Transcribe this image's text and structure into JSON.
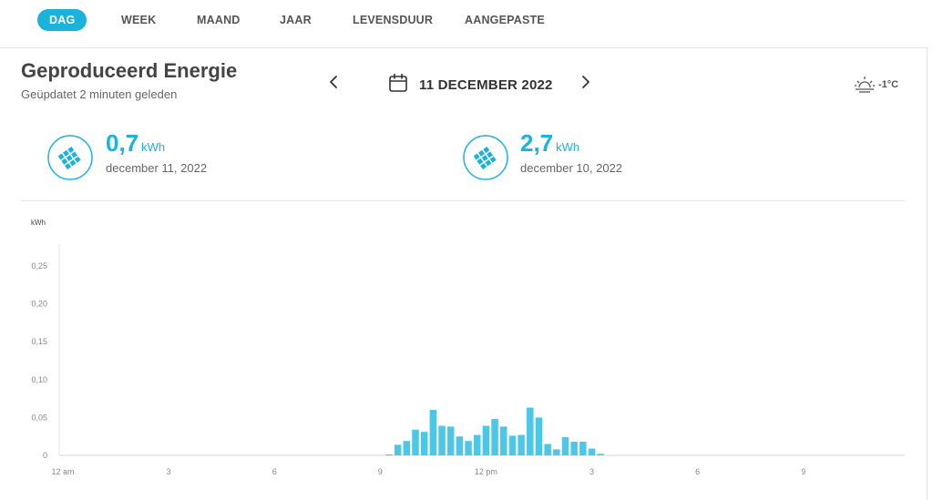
{
  "tabs": [
    {
      "label": "DAG",
      "active": true
    },
    {
      "label": "WEEK",
      "active": false
    },
    {
      "label": "MAAND",
      "active": false
    },
    {
      "label": "JAAR",
      "active": false
    },
    {
      "label": "LEVENSDUUR",
      "active": false
    },
    {
      "label": "AANGEPASTE",
      "active": false
    }
  ],
  "header": {
    "title": "Geproduceerd Energie",
    "subtitle": "Geüpdatet 2 minuten geleden",
    "date": "11 DECEMBER 2022",
    "temperature": "-1°C",
    "weather_icon": "sun-horizon-icon",
    "prev_icon": "chevron-left-icon",
    "next_icon": "chevron-right-icon",
    "calendar_icon": "calendar-icon"
  },
  "stats": [
    {
      "value": "0,7",
      "unit": "kWh",
      "date": "december 11, 2022",
      "icon": "solar-panel-icon"
    },
    {
      "value": "2,7",
      "unit": "kWh",
      "date": "december 10, 2022",
      "icon": "solar-panel-icon"
    }
  ],
  "colors": {
    "accent": "#1ab3dc",
    "bar": "#4cc7e8"
  },
  "chart_data": {
    "type": "bar",
    "ylabel": "kWh",
    "ylim": [
      0,
      0.27
    ],
    "yticks": [
      "0",
      "0,05",
      "0,10",
      "0,15",
      "0,20",
      "0,25"
    ],
    "ytick_values": [
      0,
      0.05,
      0.1,
      0.15,
      0.2,
      0.25
    ],
    "xticks": [
      "12 am",
      "3",
      "6",
      "9",
      "12 pm",
      "3",
      "6",
      "9"
    ],
    "xtick_hours": [
      0,
      3,
      6,
      9,
      12,
      15,
      18,
      21
    ],
    "x_range_hours": [
      0,
      24
    ],
    "grid": false,
    "bars": [
      {
        "hour": 9.25,
        "value": 0.001
      },
      {
        "hour": 9.5,
        "value": 0.014
      },
      {
        "hour": 9.75,
        "value": 0.019
      },
      {
        "hour": 10.0,
        "value": 0.034
      },
      {
        "hour": 10.25,
        "value": 0.031
      },
      {
        "hour": 10.5,
        "value": 0.06
      },
      {
        "hour": 10.75,
        "value": 0.039
      },
      {
        "hour": 11.0,
        "value": 0.038
      },
      {
        "hour": 11.25,
        "value": 0.025
      },
      {
        "hour": 11.5,
        "value": 0.019
      },
      {
        "hour": 11.75,
        "value": 0.027
      },
      {
        "hour": 12.0,
        "value": 0.039
      },
      {
        "hour": 12.25,
        "value": 0.048
      },
      {
        "hour": 12.5,
        "value": 0.038
      },
      {
        "hour": 12.75,
        "value": 0.026
      },
      {
        "hour": 13.0,
        "value": 0.027
      },
      {
        "hour": 13.25,
        "value": 0.063
      },
      {
        "hour": 13.5,
        "value": 0.05
      },
      {
        "hour": 13.75,
        "value": 0.015
      },
      {
        "hour": 14.0,
        "value": 0.008
      },
      {
        "hour": 14.25,
        "value": 0.024
      },
      {
        "hour": 14.5,
        "value": 0.018
      },
      {
        "hour": 14.75,
        "value": 0.018
      },
      {
        "hour": 15.0,
        "value": 0.009
      },
      {
        "hour": 15.25,
        "value": 0.002
      }
    ]
  }
}
